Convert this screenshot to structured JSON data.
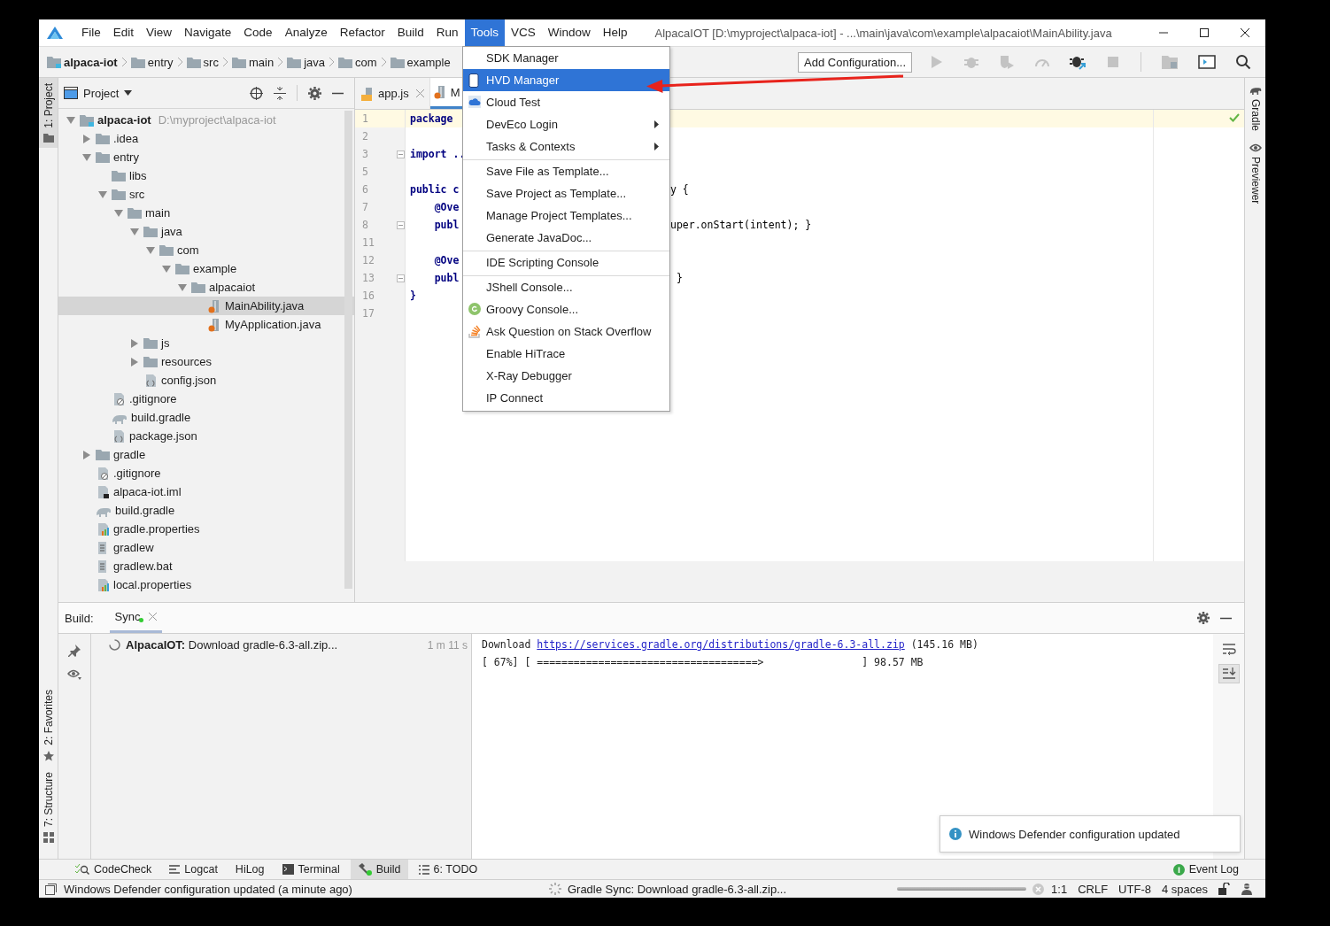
{
  "window": {
    "title": "AlpacaIOT [D:\\myproject\\alpaca-iot] - ...\\main\\java\\com\\example\\alpacaiot\\MainAbility.java"
  },
  "menu_bar": [
    {
      "label": "File",
      "selected": false
    },
    {
      "label": "Edit",
      "selected": false
    },
    {
      "label": "View",
      "selected": false
    },
    {
      "label": "Navigate",
      "selected": false
    },
    {
      "label": "Code",
      "selected": false
    },
    {
      "label": "Analyze",
      "selected": false
    },
    {
      "label": "Refactor",
      "selected": false
    },
    {
      "label": "Build",
      "selected": false
    },
    {
      "label": "Run",
      "selected": false
    },
    {
      "label": "Tools",
      "selected": true
    },
    {
      "label": "VCS",
      "selected": false
    },
    {
      "label": "Window",
      "selected": false
    },
    {
      "label": "Help",
      "selected": false
    }
  ],
  "breadcrumbs": [
    {
      "label": "alpaca-iot",
      "kind": "module"
    },
    {
      "label": "entry",
      "kind": "folder"
    },
    {
      "label": "src",
      "kind": "folder"
    },
    {
      "label": "main",
      "kind": "folder"
    },
    {
      "label": "java",
      "kind": "folder"
    },
    {
      "label": "com",
      "kind": "folder"
    },
    {
      "label": "example",
      "kind": "folder"
    }
  ],
  "run_config": {
    "label": "Add Configuration..."
  },
  "tools_menu": {
    "items": [
      {
        "label": "SDK Manager",
        "selected": false,
        "submenu": false,
        "separator_before": false
      },
      {
        "label": "HVD Manager",
        "selected": true,
        "submenu": false,
        "separator_before": false
      },
      {
        "label": "Cloud Test",
        "selected": false,
        "submenu": false,
        "separator_before": false
      },
      {
        "label": "DevEco Login",
        "selected": false,
        "submenu": true,
        "separator_before": false
      },
      {
        "label": "Tasks & Contexts",
        "selected": false,
        "submenu": true,
        "separator_before": false
      },
      {
        "label": "Save File as Template...",
        "selected": false,
        "submenu": false,
        "separator_before": true
      },
      {
        "label": "Save Project as Template...",
        "selected": false,
        "submenu": false,
        "separator_before": false
      },
      {
        "label": "Manage Project Templates...",
        "selected": false,
        "submenu": false,
        "separator_before": false
      },
      {
        "label": "Generate JavaDoc...",
        "selected": false,
        "submenu": false,
        "separator_before": false
      },
      {
        "label": "IDE Scripting Console",
        "selected": false,
        "submenu": false,
        "separator_before": true
      },
      {
        "label": "JShell Console...",
        "selected": false,
        "submenu": false,
        "separator_before": true
      },
      {
        "label": "Groovy Console...",
        "selected": false,
        "submenu": false,
        "separator_before": false
      },
      {
        "label": "Ask Question on Stack Overflow",
        "selected": false,
        "submenu": false,
        "separator_before": false
      },
      {
        "label": "Enable HiTrace",
        "selected": false,
        "submenu": false,
        "separator_before": false
      },
      {
        "label": "X-Ray Debugger",
        "selected": false,
        "submenu": false,
        "separator_before": false
      },
      {
        "label": "IP Connect",
        "selected": false,
        "submenu": false,
        "separator_before": false
      }
    ]
  },
  "left_tool_strip": [
    {
      "label": "1: Project",
      "selected": true
    },
    {
      "label": "2: Favorites",
      "selected": false
    },
    {
      "label": "7: Structure",
      "selected": false
    }
  ],
  "right_tool_strip": [
    {
      "label": "Gradle"
    },
    {
      "label": "Previewer"
    }
  ],
  "project_panel": {
    "title": "Project",
    "tree": [
      {
        "label": "alpaca-iot",
        "hint": "D:\\myproject\\alpaca-iot",
        "kind": "module",
        "selected": false,
        "expanded": true,
        "children": [
          {
            "label": ".idea",
            "kind": "folder",
            "selected": false,
            "expanded": false
          },
          {
            "label": "entry",
            "kind": "folder",
            "selected": false,
            "expanded": true,
            "children": [
              {
                "label": "libs",
                "kind": "folder",
                "selected": false
              },
              {
                "label": "src",
                "kind": "folder",
                "selected": false,
                "expanded": true,
                "children": [
                  {
                    "label": "main",
                    "kind": "folder",
                    "selected": false,
                    "expanded": true,
                    "children": [
                      {
                        "label": "java",
                        "kind": "folder",
                        "selected": false,
                        "expanded": true,
                        "children": [
                          {
                            "label": "com",
                            "kind": "folder",
                            "selected": false,
                            "expanded": true,
                            "children": [
                              {
                                "label": "example",
                                "kind": "folder",
                                "selected": false,
                                "expanded": true,
                                "children": [
                                  {
                                    "label": "alpacaiot",
                                    "kind": "folder",
                                    "selected": false,
                                    "expanded": true,
                                    "children": [
                                      {
                                        "label": "MainAbility.java",
                                        "kind": "java",
                                        "selected": true
                                      },
                                      {
                                        "label": "MyApplication.java",
                                        "kind": "java",
                                        "selected": false
                                      }
                                    ]
                                  }
                                ]
                              }
                            ]
                          }
                        ]
                      },
                      {
                        "label": "js",
                        "kind": "folder",
                        "selected": false,
                        "expanded": false
                      },
                      {
                        "label": "resources",
                        "kind": "folder",
                        "selected": false,
                        "expanded": false
                      },
                      {
                        "label": "config.json",
                        "kind": "json",
                        "selected": false
                      }
                    ]
                  }
                ]
              },
              {
                "label": ".gitignore",
                "kind": "ignore",
                "selected": false
              },
              {
                "label": "build.gradle",
                "kind": "gradle",
                "selected": false
              },
              {
                "label": "package.json",
                "kind": "json",
                "selected": false
              }
            ]
          },
          {
            "label": "gradle",
            "kind": "folder",
            "selected": false,
            "expanded": false
          },
          {
            "label": ".gitignore",
            "kind": "ignore",
            "selected": false
          },
          {
            "label": "alpaca-iot.iml",
            "kind": "iml",
            "selected": false
          },
          {
            "label": "build.gradle",
            "kind": "gradle",
            "selected": false
          },
          {
            "label": "gradle.properties",
            "kind": "properties",
            "selected": false
          },
          {
            "label": "gradlew",
            "kind": "script",
            "selected": false
          },
          {
            "label": "gradlew.bat",
            "kind": "script",
            "selected": false
          },
          {
            "label": "local.properties",
            "kind": "properties",
            "selected": false
          }
        ]
      }
    ]
  },
  "editor": {
    "tabs": [
      {
        "label": "app.js",
        "kind": "js",
        "selected": false
      },
      {
        "label": "M",
        "kind": "java",
        "selected": true
      }
    ],
    "lines": [
      {
        "number": "1",
        "code": "package",
        "current": true,
        "fold": false
      },
      {
        "number": "2",
        "current": false,
        "fold": false
      },
      {
        "number": "3",
        "code": "import ..",
        "current": false,
        "fold": true
      },
      {
        "number": "5",
        "current": false,
        "fold": false
      },
      {
        "number": "6",
        "code": "public c",
        "right": "y {",
        "current": false,
        "fold": false
      },
      {
        "number": "7",
        "code": "    @Ove",
        "current": false,
        "fold": false
      },
      {
        "number": "8",
        "code": "    publ",
        "right": "uper.onStart(intent); }",
        "current": false,
        "fold": true
      },
      {
        "number": "11",
        "current": false,
        "fold": false
      },
      {
        "number": "12",
        "code": "    @Ove",
        "current": false,
        "fold": false
      },
      {
        "number": "13",
        "code": "    publ",
        "right": " }",
        "current": false,
        "fold": true
      },
      {
        "number": "16",
        "code": "}",
        "current": false,
        "fold": false
      },
      {
        "number": "17",
        "current": false,
        "fold": false
      }
    ]
  },
  "build_panel": {
    "title": "Build:",
    "tabs": [
      {
        "label": "Sync",
        "selected": true
      }
    ],
    "tasks": [
      {
        "text": "**AlpacaIOT:** Download gradle-6.3-all.zip...",
        "time": "1 m 11 s"
      }
    ],
    "console": [
      {
        "text": "Download ",
        "link": "https://services.gradle.org/distributions/gradle-6.3-all.zip",
        "after": " (145.16 MB)"
      },
      {
        "text": "[ 67%] [ ====================================>                ] 98.57 MB"
      }
    ]
  },
  "notification": {
    "text": "Windows Defender configuration updated"
  },
  "tool_tabs": [
    {
      "label": "CodeCheck",
      "selected": false
    },
    {
      "label": "Logcat",
      "selected": false
    },
    {
      "label": "HiLog",
      "selected": false
    },
    {
      "label": "Terminal",
      "selected": false
    },
    {
      "label": "Build",
      "selected": true
    },
    {
      "label": "6: TODO",
      "selected": false
    }
  ],
  "event_log": {
    "label": "Event Log"
  },
  "status_bar": {
    "message": "Windows Defender configuration updated (a minute ago)",
    "task": "Gradle Sync: Download gradle-6.3-all.zip...",
    "position": "1:1",
    "line_separator": "CRLF",
    "encoding": "UTF-8",
    "indent": "4 spaces",
    "progress": {
      "level": 1
    }
  }
}
